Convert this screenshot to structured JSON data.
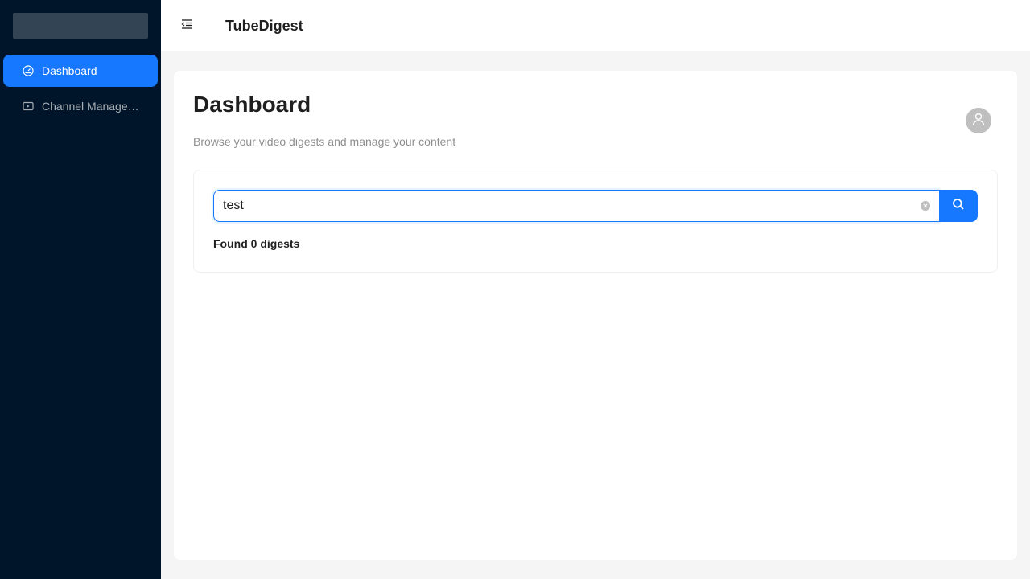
{
  "sidebar": {
    "items": [
      {
        "label": "Dashboard",
        "icon": "dashboard-icon",
        "active": true
      },
      {
        "label": "Channel Management",
        "icon": "video-icon",
        "active": false
      }
    ]
  },
  "header": {
    "title": "TubeDigest",
    "collapse_icon": "menu-fold-icon"
  },
  "main": {
    "title": "Dashboard",
    "subtitle": "Browse your video digests and manage your content",
    "avatar_icon": "user-icon",
    "search": {
      "value": "test",
      "placeholder": "",
      "button_icon": "search-icon"
    },
    "result_text": "Found 0 digests"
  },
  "colors": {
    "sidebar_bg": "#001529",
    "accent": "#1677ff",
    "page_bg": "#f5f5f5"
  }
}
